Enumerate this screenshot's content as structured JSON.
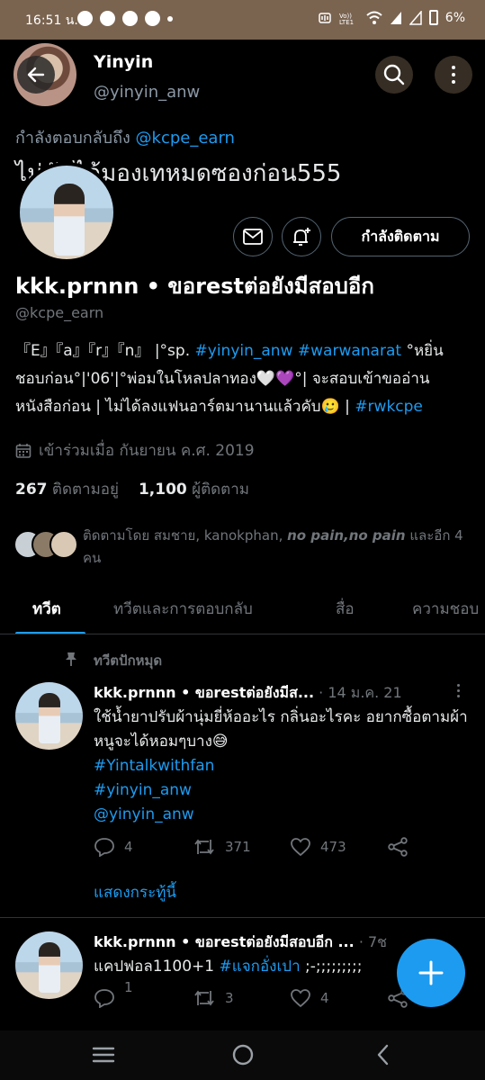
{
  "status_bar": {
    "time": "16:51 น.",
    "battery": "6%",
    "icons": [
      "messenger-icon",
      "chat-icon",
      "line-icon",
      "location-icon",
      "mute-icon",
      "volte-icon",
      "wifi-icon",
      "signal-icon",
      "battery-icon"
    ]
  },
  "header": {
    "name": "Yinyin",
    "handle": "@yinyin_anw"
  },
  "pinned_reply": {
    "prefix": "กำลังตอบกลับถึง",
    "handle": "@kcpe_earn",
    "text": "ไม่ทันได้มองเทหมดซองก่อน555"
  },
  "profile": {
    "follow_label": "กำลังติดตาม",
    "name": "kkk.prnnn • ขอrestต่อยังมีสอบอีก",
    "handle": "@kcpe_earn",
    "bio_part1": "『E』『a』『r』『n』 |°sp.",
    "bio_link1": "#yinyin_anw",
    "bio_link2": "#warwanarat",
    "bio_part2": "°หยิ่นชอบก่อน°|'06'|°พ่อมในโหลปลาทอง🤍💜°| จะสอบเข้าขออ่านหนังสือก่อน | ไม่ได้ลงแฟนอาร์ตมานานแล้วคับ🥲 |",
    "bio_link3": "#rwkcpe",
    "joined": "เข้าร่วมเมื่อ กันยายน ค.ศ. 2019",
    "following_count": "267",
    "following_label": "ติดตามอยู่",
    "followers_count": "1,100",
    "followers_label": "ผู้ติดตาม",
    "followed_by_prefix": "ติดตามโดย สมชาย, kanokphan,",
    "followed_by_bold": "no pain,no pain",
    "followed_by_suffix": "และอีก 4 คน"
  },
  "tabs": [
    "ทวีต",
    "ทวีตและการตอบกลับ",
    "สื่อ",
    "ความชอบ"
  ],
  "pinned_label": "ทวีตปักหมุด",
  "tweets": [
    {
      "author": "kkk.prnnn • ขอrestต่อยังมีส...",
      "meta": "· 14 ม.ค. 21",
      "text": "ใช้น้ำยาปรับผ้านุ่มยี่ห้ออะไร กลิ่นอะไรคะ อยากซื้อตามผ้าหนูจะได้หอมๆบาง😅",
      "tags": [
        "#Yintalkwithfan",
        "#yinyin_anw",
        "@yinyin_anw"
      ],
      "replies": "4",
      "retweets": "371",
      "likes": "473"
    },
    {
      "author": "kkk.prnnn • ขอrestต่อยังมีสอบอีก ...",
      "meta": "· 7ช",
      "text": "แคปฟอล1100+1",
      "tag": "#แจกอั่งเปา",
      "text_suffix": ";-;;;;;;;;;",
      "replies": "1",
      "retweets": "3",
      "likes": "4"
    }
  ],
  "show_thread": "แสดงกระทู้นี้",
  "colors": {
    "accent": "#1d9bf0",
    "background": "#000000",
    "secondary_text": "#71767b",
    "status_bar": "#7a6450"
  }
}
